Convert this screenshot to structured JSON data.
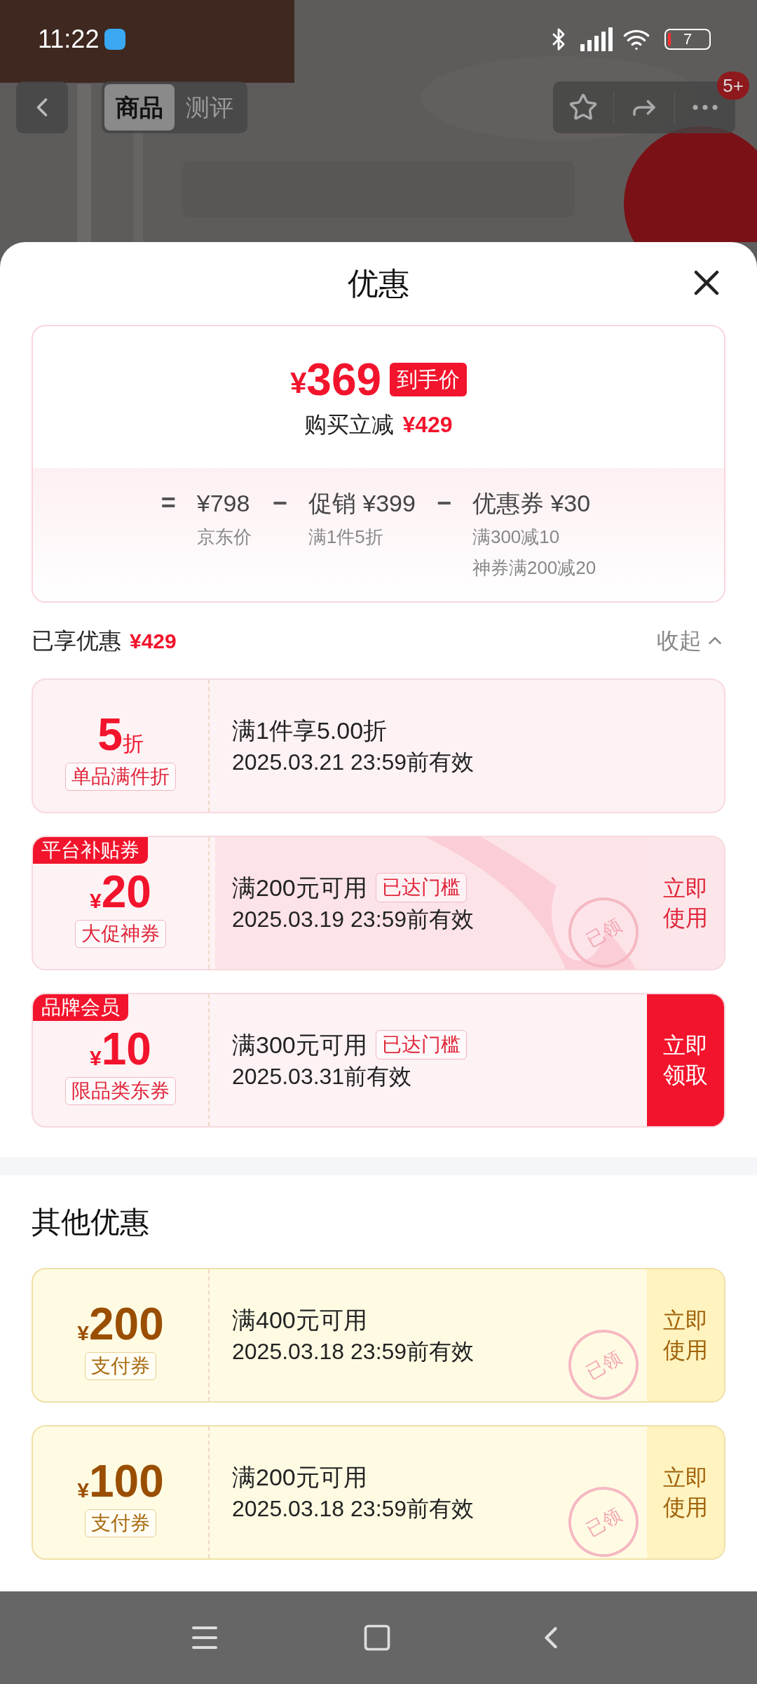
{
  "status_bar": {
    "time": "11:22",
    "battery": "7"
  },
  "header": {
    "tabs": [
      {
        "label": "商品",
        "selected": true
      },
      {
        "label": "测评",
        "selected": false
      }
    ],
    "badge": "5+"
  },
  "sheet": {
    "title": "优惠",
    "price_card": {
      "price_currency": "¥",
      "price": "369",
      "price_tag": "到手价",
      "savings_label": "购买立减",
      "savings_value": "¥429",
      "breakdown": [
        {
          "operator": "=",
          "title": "¥798",
          "notes": [
            "京东价"
          ]
        },
        {
          "operator": "−",
          "title": "促销 ¥399",
          "notes": [
            "满1件5折"
          ]
        },
        {
          "operator": "−",
          "title": "优惠券 ¥30",
          "notes": [
            "满300减10",
            "神券满200减20"
          ]
        }
      ]
    },
    "enjoyed": {
      "label": "已享优惠",
      "value": "¥429",
      "toggle": "收起",
      "expanded": true
    },
    "coupons": [
      {
        "kind": "discount",
        "value": "5",
        "unit": "折",
        "type_tag": "单品满件折",
        "condition": "满1件享5.00折",
        "validity": "2025.03.21 23:59前有效"
      },
      {
        "kind": "amount",
        "corner_tag": "平台补贴券",
        "currency": "¥",
        "value": "20",
        "type_tag": "大促神券",
        "condition": "满200元可用",
        "threshold_tag": "已达门槛",
        "validity": "2025.03.19 23:59前有效",
        "action": "立即使用",
        "highlighted": false,
        "stamp": "已领",
        "decorated": true
      },
      {
        "kind": "amount",
        "corner_tag": "品牌会员",
        "currency": "¥",
        "value": "10",
        "type_tag": "限品类东券",
        "condition": "满300元可用",
        "threshold_tag": "已达门槛",
        "validity": "2025.03.31前有效",
        "action": "立即领取",
        "highlighted": true
      }
    ],
    "other_title": "其他优惠",
    "other_coupons": [
      {
        "kind": "amount",
        "currency": "¥",
        "value": "200",
        "type_tag": "支付券",
        "condition": "满400元可用",
        "validity": "2025.03.18 23:59前有效",
        "action": "立即使用",
        "highlighted": false,
        "stamp": "已领"
      },
      {
        "kind": "amount",
        "currency": "¥",
        "value": "100",
        "type_tag": "支付券",
        "condition": "满200元可用",
        "validity": "2025.03.18 23:59前有效",
        "action": "立即使用",
        "highlighted": false,
        "stamp": "已领"
      }
    ]
  }
}
